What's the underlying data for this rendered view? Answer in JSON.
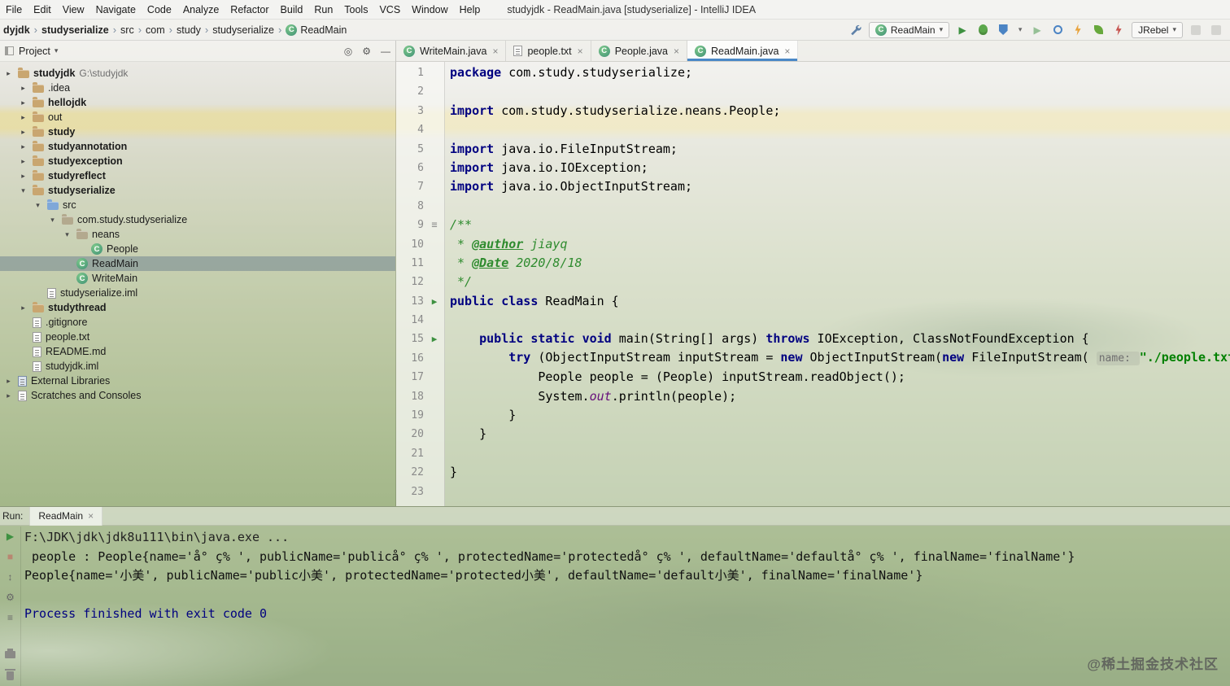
{
  "window": {
    "title": "studyjdk - ReadMain.java [studyserialize] - IntelliJ IDEA"
  },
  "menu_bar": {
    "items": [
      "File",
      "Edit",
      "View",
      "Navigate",
      "Code",
      "Analyze",
      "Refactor",
      "Build",
      "Run",
      "Tools",
      "VCS",
      "Window",
      "Help"
    ]
  },
  "nav_bar": {
    "breadcrumbs": [
      {
        "label": "dyjdk",
        "bold": true
      },
      {
        "label": "studyserialize",
        "bold": true
      },
      {
        "label": "src"
      },
      {
        "label": "com"
      },
      {
        "label": "study"
      },
      {
        "label": "studyserialize"
      },
      {
        "label": "ReadMain",
        "icon": "class"
      }
    ],
    "run_config": "ReadMain",
    "jrebel": "JRebel"
  },
  "project_panel": {
    "title": "Project",
    "tree": [
      {
        "label": "studyjdk",
        "suffix": " G:\\studyjdk",
        "depth": 0,
        "chevron": "collapsed",
        "icon": "folder",
        "bold": true
      },
      {
        "label": ".idea",
        "depth": 1,
        "chevron": "collapsed",
        "icon": "folder"
      },
      {
        "label": "hellojdk",
        "depth": 1,
        "chevron": "collapsed",
        "icon": "folder",
        "bold": true
      },
      {
        "label": "out",
        "depth": 1,
        "chevron": "collapsed",
        "icon": "folder"
      },
      {
        "label": "study",
        "depth": 1,
        "chevron": "collapsed",
        "icon": "folder",
        "bold": true
      },
      {
        "label": "studyannotation",
        "depth": 1,
        "chevron": "collapsed",
        "icon": "folder",
        "bold": true
      },
      {
        "label": "studyexception",
        "depth": 1,
        "chevron": "collapsed",
        "icon": "folder",
        "bold": true
      },
      {
        "label": "studyreflect",
        "depth": 1,
        "chevron": "collapsed",
        "icon": "folder",
        "bold": true
      },
      {
        "label": "studyserialize",
        "depth": 1,
        "chevron": "expanded",
        "icon": "folder",
        "bold": true
      },
      {
        "label": "src",
        "depth": 2,
        "chevron": "expanded",
        "icon": "src-folder"
      },
      {
        "label": "com.study.studyserialize",
        "depth": 3,
        "chevron": "expanded",
        "icon": "package"
      },
      {
        "label": "neans",
        "depth": 4,
        "chevron": "expanded",
        "icon": "package"
      },
      {
        "label": "People",
        "depth": 5,
        "icon": "class"
      },
      {
        "label": "ReadMain",
        "depth": 4,
        "icon": "class",
        "selected": true
      },
      {
        "label": "WriteMain",
        "depth": 4,
        "icon": "class"
      },
      {
        "label": "studyserialize.iml",
        "depth": 2,
        "icon": "file"
      },
      {
        "label": "studythread",
        "depth": 1,
        "chevron": "collapsed",
        "icon": "folder",
        "bold": true
      },
      {
        "label": ".gitignore",
        "depth": 1,
        "icon": "file"
      },
      {
        "label": "people.txt",
        "depth": 1,
        "icon": "text"
      },
      {
        "label": "README.md",
        "depth": 1,
        "icon": "file"
      },
      {
        "label": "studyjdk.iml",
        "depth": 1,
        "icon": "file"
      },
      {
        "label": "External Libraries",
        "depth": 0,
        "chevron": "collapsed",
        "icon": "library"
      },
      {
        "label": "Scratches and Consoles",
        "depth": 0,
        "chevron": "collapsed",
        "icon": "scratch"
      }
    ]
  },
  "editor": {
    "tabs": [
      {
        "label": "WriteMain.java",
        "icon": "class"
      },
      {
        "label": "people.txt",
        "icon": "text"
      },
      {
        "label": "People.java",
        "icon": "class"
      },
      {
        "label": "ReadMain.java",
        "icon": "class",
        "active": true
      }
    ],
    "lines": [
      {
        "t": [
          [
            "k",
            "package"
          ],
          [
            "p",
            " com.study.studyserialize;"
          ]
        ]
      },
      {
        "t": []
      },
      {
        "t": [
          [
            "k",
            "import"
          ],
          [
            "p",
            " com.study.studyserialize.neans.People;"
          ]
        ]
      },
      {
        "t": []
      },
      {
        "t": [
          [
            "k",
            "import"
          ],
          [
            "p",
            " java.io.FileInputStream;"
          ]
        ]
      },
      {
        "t": [
          [
            "k",
            "import"
          ],
          [
            "p",
            " java.io.IOException;"
          ]
        ]
      },
      {
        "t": [
          [
            "k",
            "import"
          ],
          [
            "p",
            " java.io.ObjectInputStream;"
          ]
        ]
      },
      {
        "t": []
      },
      {
        "g": "doc",
        "t": [
          [
            "c",
            "/**"
          ]
        ]
      },
      {
        "t": [
          [
            "c",
            " * "
          ],
          [
            "cg",
            "@author"
          ],
          [
            "c",
            " jiayq"
          ]
        ]
      },
      {
        "t": [
          [
            "c",
            " * "
          ],
          [
            "cg",
            "@Date"
          ],
          [
            "c",
            " 2020/8/18"
          ]
        ]
      },
      {
        "t": [
          [
            "c",
            " */"
          ]
        ]
      },
      {
        "g": "run",
        "t": [
          [
            "k",
            "public"
          ],
          [
            "p",
            " "
          ],
          [
            "k",
            "class"
          ],
          [
            "p",
            " ReadMain {"
          ]
        ]
      },
      {
        "t": []
      },
      {
        "g": "run",
        "t": [
          [
            "p",
            "    "
          ],
          [
            "k",
            "public"
          ],
          [
            "p",
            " "
          ],
          [
            "k",
            "static"
          ],
          [
            "p",
            " "
          ],
          [
            "k",
            "void"
          ],
          [
            "p",
            " main(String[] args) "
          ],
          [
            "k",
            "throws"
          ],
          [
            "p",
            " IOException, ClassNotFoundException {"
          ]
        ]
      },
      {
        "t": [
          [
            "p",
            "        "
          ],
          [
            "k",
            "try"
          ],
          [
            "p",
            " (ObjectInputStream inputStream = "
          ],
          [
            "k",
            "new"
          ],
          [
            "p",
            " ObjectInputStream("
          ],
          [
            "k",
            "new"
          ],
          [
            "p",
            " FileInputStream( "
          ],
          [
            "h",
            "name: "
          ],
          [
            "s",
            "\"./people.txt\""
          ]
        ]
      },
      {
        "t": [
          [
            "p",
            "            People people = (People) inputStream.readObject();"
          ]
        ]
      },
      {
        "t": [
          [
            "p",
            "            System."
          ],
          [
            "f",
            "out"
          ],
          [
            "p",
            ".println(people);"
          ]
        ]
      },
      {
        "t": [
          [
            "p",
            "        }"
          ]
        ]
      },
      {
        "t": [
          [
            "p",
            "    }"
          ]
        ]
      },
      {
        "t": []
      },
      {
        "t": [
          [
            "p",
            "}"
          ]
        ]
      },
      {
        "t": []
      }
    ]
  },
  "run_panel": {
    "label": "Run:",
    "tab": "ReadMain",
    "output": [
      {
        "cls": "path",
        "text": "F:\\JDK\\jdk\\jdk8u111\\bin\\java.exe ..."
      },
      {
        "cls": "out",
        "text": " people : People{name='å° ç% ', publicName='publicå° ç% ', protectedName='protectedå° ç% ', defaultName='defaultå° ç% ', finalName='finalName'}"
      },
      {
        "cls": "out",
        "text": "People{name='小美', publicName='public小美', protectedName='protected小美', defaultName='default小美', finalName='finalName'}"
      },
      {
        "cls": "out",
        "text": ""
      },
      {
        "cls": "sys",
        "text": "Process finished with exit code 0"
      }
    ]
  },
  "watermark": "@稀土掘金技术社区",
  "icons": {
    "chevron_collapsed": "▸",
    "chevron_expanded": "▾",
    "crumb_sep": "›",
    "caret_down": "▾",
    "close": "×",
    "run_arrow": "▶",
    "doc_fold": "≡",
    "stop_square": "■",
    "updown": "↕",
    "gear": "⚙",
    "target": "◎",
    "minimize": "—",
    "class_letter": "C"
  }
}
